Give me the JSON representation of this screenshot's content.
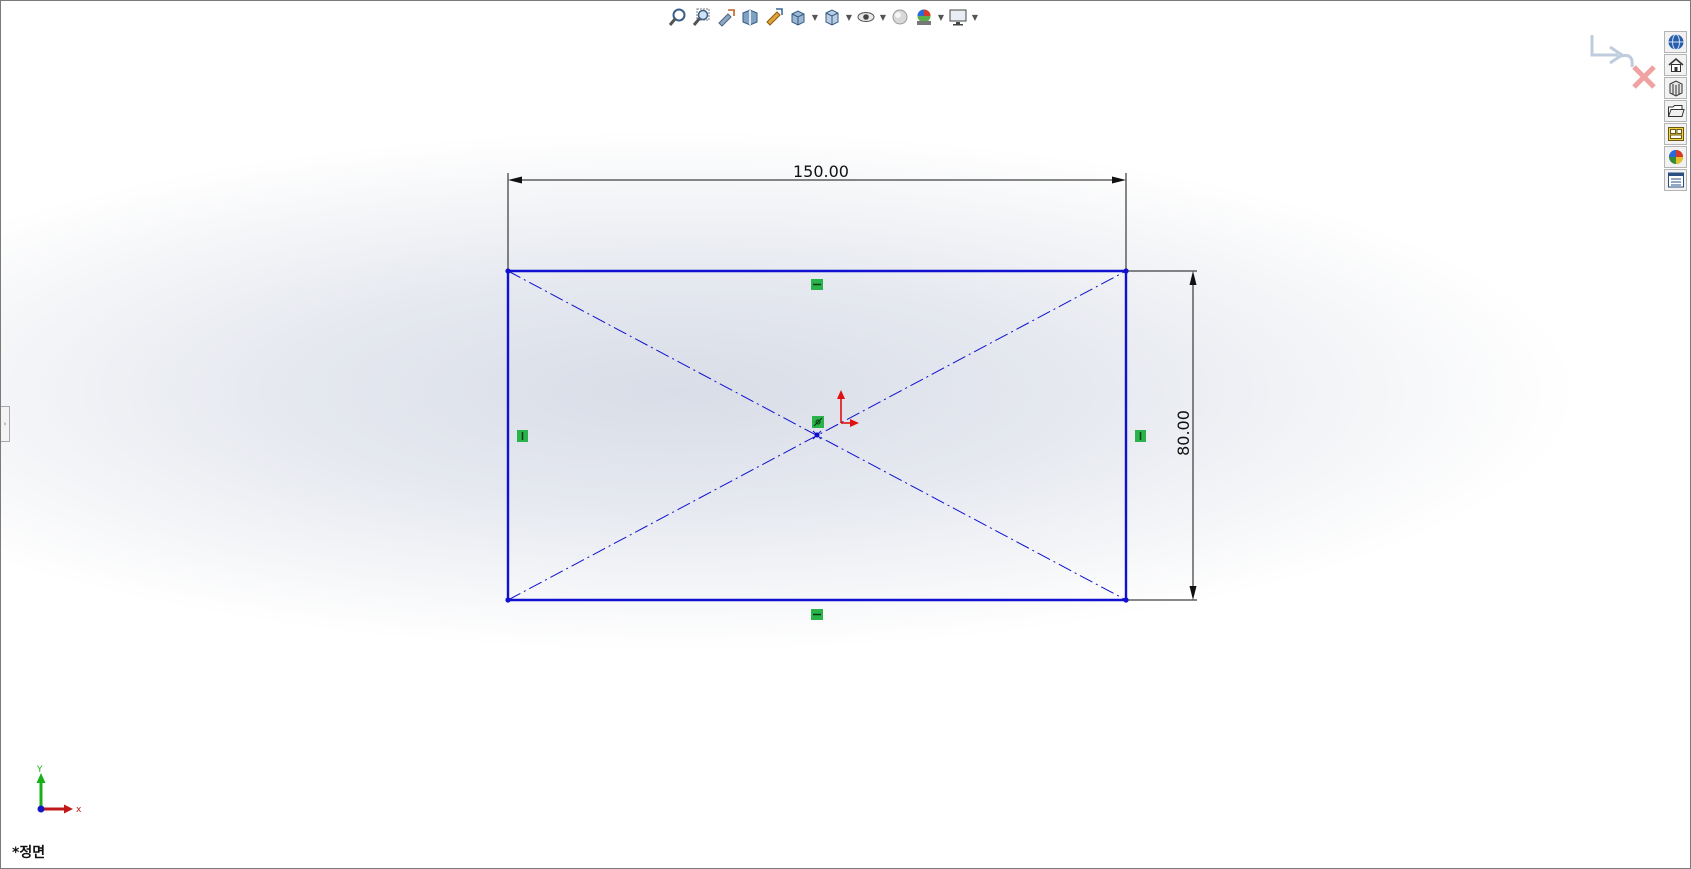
{
  "hud_toolbar": {
    "items": [
      {
        "name": "zoom-to-fit-icon"
      },
      {
        "name": "zoom-to-area-icon"
      },
      {
        "name": "previous-view-icon"
      },
      {
        "name": "section-view-icon"
      },
      {
        "name": "dynamic-annotation-view-icon"
      },
      {
        "name": "view-orientation-icon",
        "dropdown": true
      },
      {
        "name": "display-style-icon",
        "dropdown": true
      },
      {
        "name": "hide-show-items-icon",
        "dropdown": true
      },
      {
        "name": "edit-appearance-icon"
      },
      {
        "name": "apply-scene-icon",
        "dropdown": true
      },
      {
        "name": "view-settings-icon",
        "dropdown": true
      }
    ]
  },
  "task_pane": {
    "tabs": [
      {
        "name": "solidworks-resources-icon"
      },
      {
        "name": "home-icon"
      },
      {
        "name": "design-library-icon"
      },
      {
        "name": "file-explorer-icon"
      },
      {
        "name": "view-palette-icon"
      },
      {
        "name": "appearances-scenes-icon"
      },
      {
        "name": "custom-properties-icon"
      }
    ]
  },
  "sketch": {
    "width_dimension": "150.00",
    "height_dimension": "80.00",
    "line_color": "#1010d0",
    "relation_color": "#2ab34a"
  },
  "view": {
    "label": "*정면",
    "triad_x": "x",
    "triad_y": "Y"
  }
}
